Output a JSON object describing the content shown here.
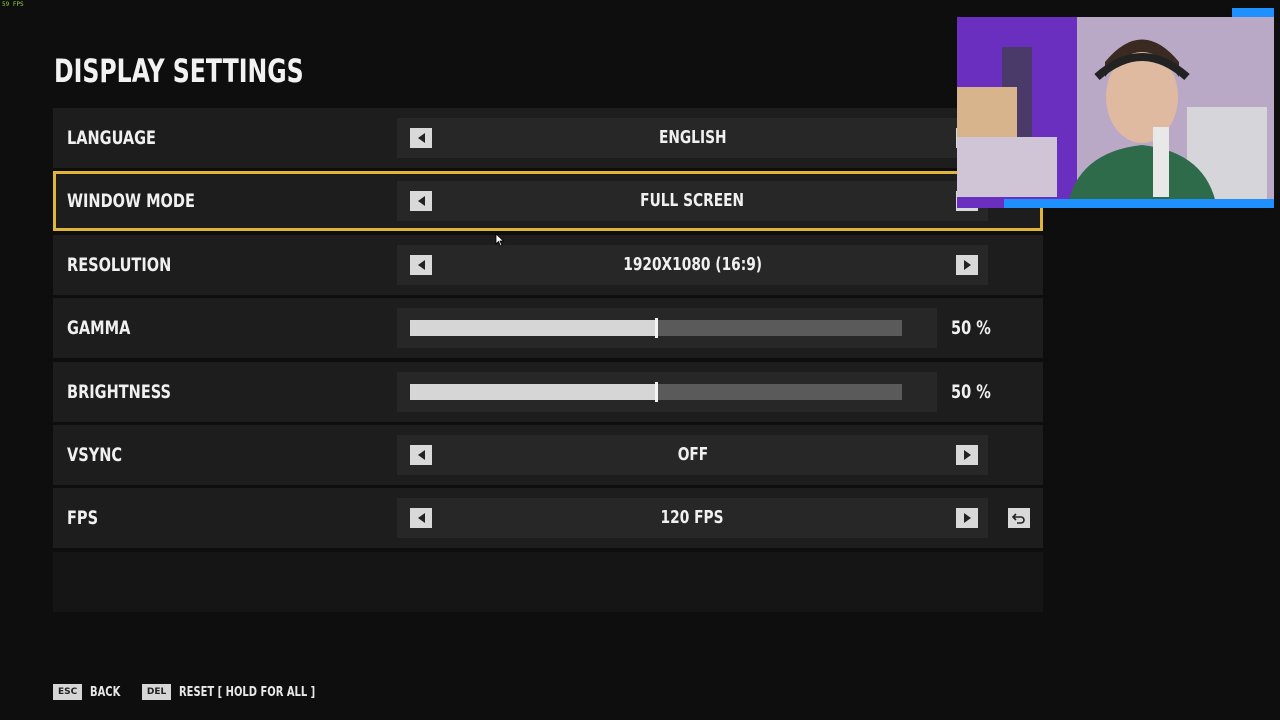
{
  "overlay": {
    "fps_counter": "59 FPS"
  },
  "page": {
    "title": "DISPLAY SETTINGS"
  },
  "settings": [
    {
      "label": "LANGUAGE",
      "type": "selector",
      "value": "ENGLISH"
    },
    {
      "label": "WINDOW MODE",
      "type": "selector",
      "value": "FULL SCREEN",
      "selected": true
    },
    {
      "label": "RESOLUTION",
      "type": "selector",
      "value": "1920X1080 (16:9)"
    },
    {
      "label": "GAMMA",
      "type": "slider",
      "value": "50 %",
      "level": 0.5
    },
    {
      "label": "BRIGHTNESS",
      "type": "slider",
      "value": "50 %",
      "level": 0.5
    },
    {
      "label": "VSYNC",
      "type": "selector",
      "value": "OFF"
    },
    {
      "label": "FPS",
      "type": "selector",
      "value": "120 FPS",
      "has_reset": true
    }
  ],
  "footer": {
    "back_key": "ESC",
    "back_label": "BACK",
    "reset_key": "DEL",
    "reset_label": "RESET [ HOLD FOR ALL ]"
  },
  "colors": {
    "accent": "#e1b43a",
    "background": "#0e0e0e",
    "row": "#1d1d1d",
    "stream_bar": "#1e90ff"
  },
  "icons": {
    "left": "arrow-left-icon",
    "right": "arrow-right-icon",
    "reset": "undo-icon",
    "cursor": "mouse-cursor-icon"
  }
}
